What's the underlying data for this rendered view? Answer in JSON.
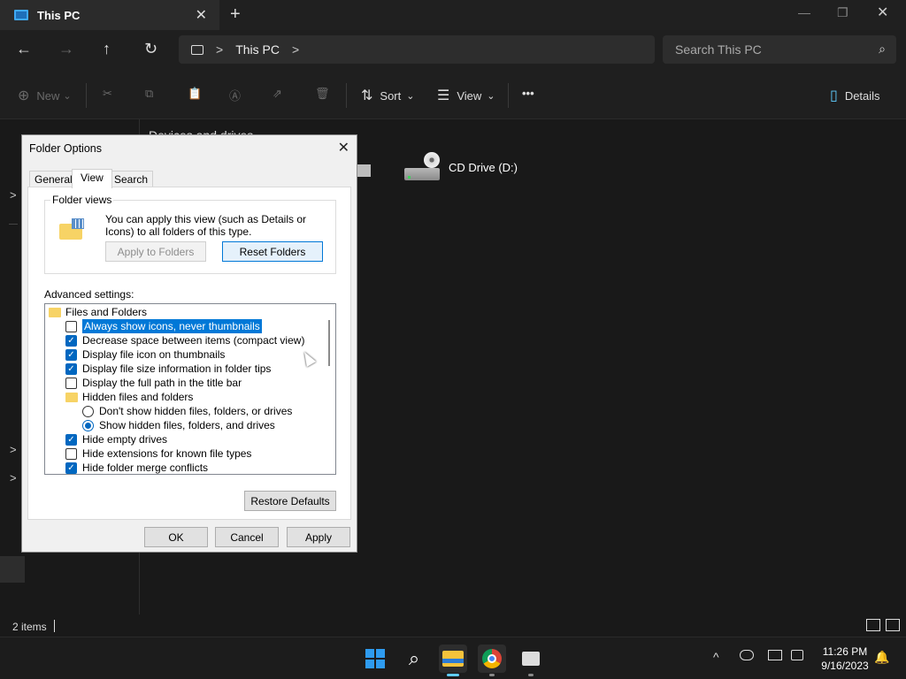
{
  "titlebar": {
    "tab_title": "This PC",
    "close": "✕",
    "new_tab": "+",
    "minimize": "—",
    "maximize": "❐",
    "close_window": "✕"
  },
  "address": {
    "back": "←",
    "forward": "→",
    "up": "↑",
    "refresh": "↻",
    "chevron1": ">",
    "crumb": "This PC",
    "chevron2": ">",
    "search_placeholder": "Search This PC",
    "search_icon": "⌕"
  },
  "commandbar": {
    "new_label": "New",
    "new_icon": "⊕",
    "cut_icon": "✂",
    "copy_icon": "⧉",
    "paste_icon": "📋",
    "rename_icon": "Ⓐ",
    "share_icon": "⇗",
    "delete_icon": "🗑",
    "sort_label": "Sort",
    "sort_icon": "⇅",
    "view_label": "View",
    "view_icon": "☰",
    "more": "•••",
    "details_label": "Details",
    "details_icon": "▯",
    "dropdown": "⌄"
  },
  "navpane": {
    "chevron": ">"
  },
  "content": {
    "section_title": "Devices and drives",
    "drive_label": "CD Drive (D:)"
  },
  "statusbar": {
    "count": "2 items"
  },
  "dialog": {
    "title": "Folder Options",
    "close": "✕",
    "tabs": [
      "General",
      "View",
      "Search"
    ],
    "folder_views": {
      "label": "Folder views",
      "text": "You can apply this view (such as Details or Icons) to all folders of this type.",
      "apply_button": "Apply to Folders",
      "reset_button": "Reset Folders"
    },
    "advanced_label": "Advanced settings:",
    "tree": [
      {
        "kind": "folder",
        "label": "Files and Folders"
      },
      {
        "kind": "check",
        "checked": false,
        "selected": true,
        "label": "Always show icons, never thumbnails"
      },
      {
        "kind": "check",
        "checked": true,
        "label": "Decrease space between items (compact view)"
      },
      {
        "kind": "check",
        "checked": true,
        "label": "Display file icon on thumbnails"
      },
      {
        "kind": "check",
        "checked": true,
        "label": "Display file size information in folder tips"
      },
      {
        "kind": "check",
        "checked": false,
        "label": "Display the full path in the title bar"
      },
      {
        "kind": "folder",
        "label": "Hidden files and folders"
      },
      {
        "kind": "radio",
        "checked": false,
        "label": "Don't show hidden files, folders, or drives"
      },
      {
        "kind": "radio",
        "checked": true,
        "label": "Show hidden files, folders, and drives"
      },
      {
        "kind": "check",
        "checked": true,
        "label": "Hide empty drives"
      },
      {
        "kind": "check",
        "checked": false,
        "label": "Hide extensions for known file types"
      },
      {
        "kind": "check",
        "checked": true,
        "label": "Hide folder merge conflicts"
      }
    ],
    "restore_button": "Restore Defaults",
    "ok_button": "OK",
    "cancel_button": "Cancel",
    "apply_button": "Apply",
    "check_glyph": "✓"
  },
  "taskbar": {
    "search_icon": "⌕",
    "tray_chevron": "^",
    "time": "11:26 PM",
    "date": "9/16/2023",
    "bell": "🔔"
  },
  "colors": {
    "accent": "#0067c0",
    "selection": "#0078d7",
    "taskbar_indicator": "#60cdff"
  }
}
